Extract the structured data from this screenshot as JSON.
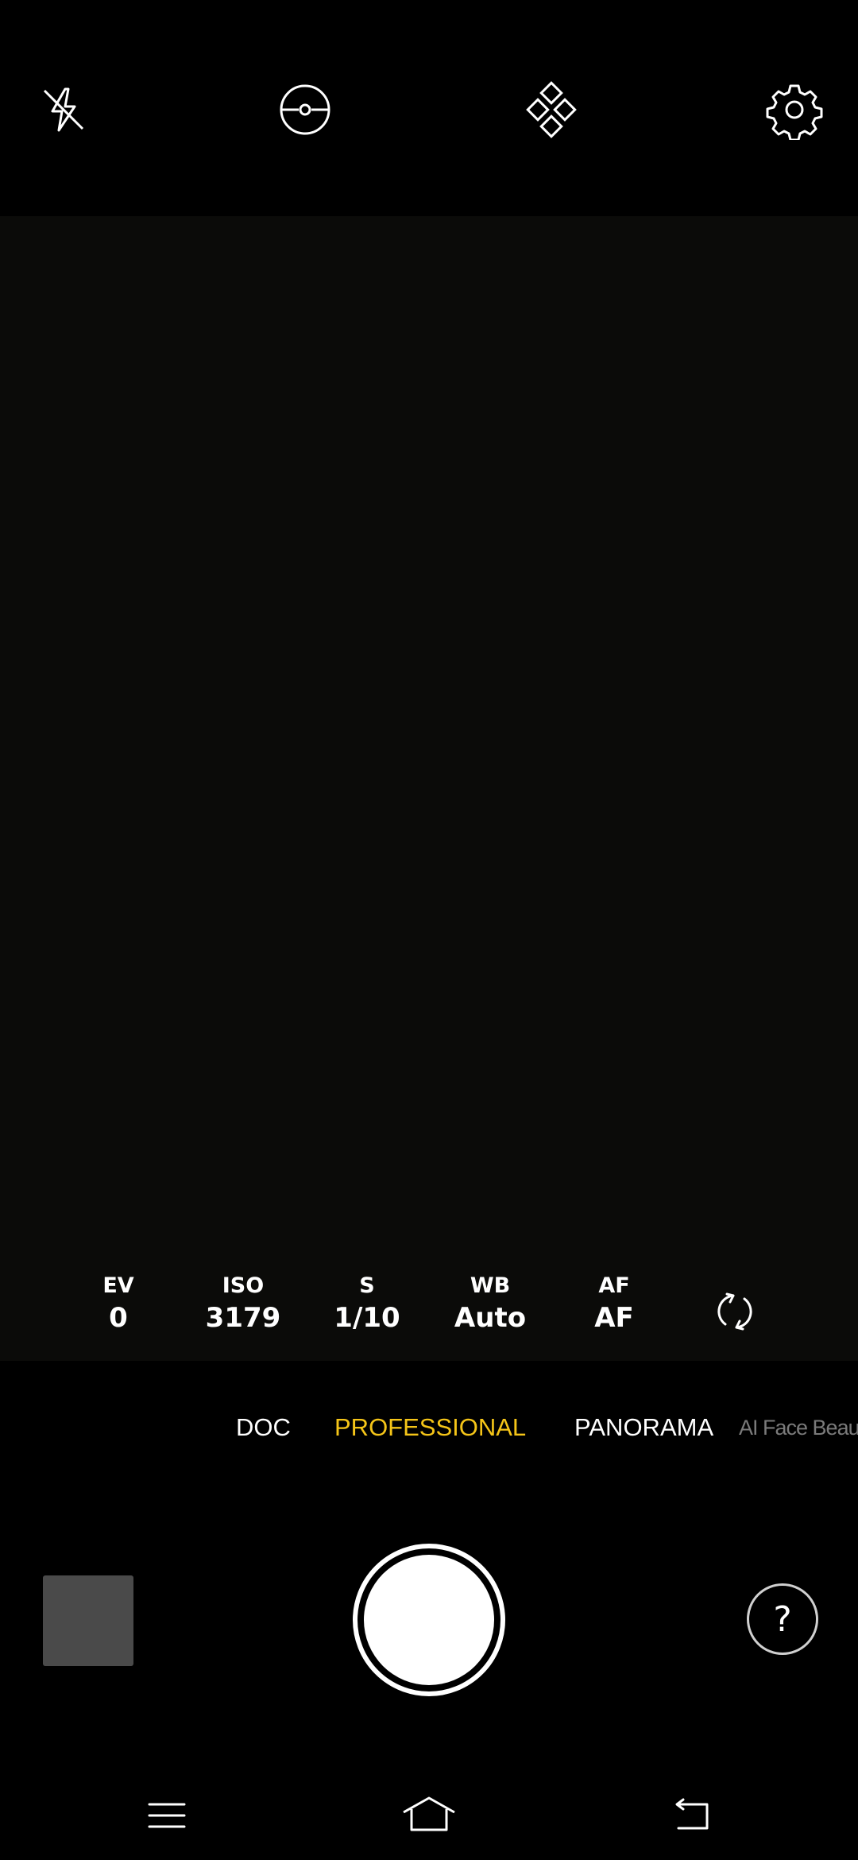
{
  "top_bar": {
    "icons": [
      "flash-off-icon",
      "level-icon",
      "filters-icon",
      "gear-icon"
    ]
  },
  "pro_settings": [
    {
      "label": "EV",
      "value": "0"
    },
    {
      "label": "ISO",
      "value": "3179"
    },
    {
      "label": "S",
      "value": "1/10"
    },
    {
      "label": "WB",
      "value": "Auto"
    },
    {
      "label": "AF",
      "value": "AF"
    }
  ],
  "modes": {
    "doc": "DOC",
    "professional": "PROFESSIONAL",
    "panorama": "PANORAMA",
    "ai_face_beauty": "AI Face Beauty",
    "active": "PROFESSIONAL"
  },
  "bottom": {
    "help_label": "?"
  },
  "colors": {
    "accent": "#f5c518",
    "background": "#000000",
    "viewfinder": "#0b0b09",
    "thumbnail": "#4a4a4a"
  }
}
